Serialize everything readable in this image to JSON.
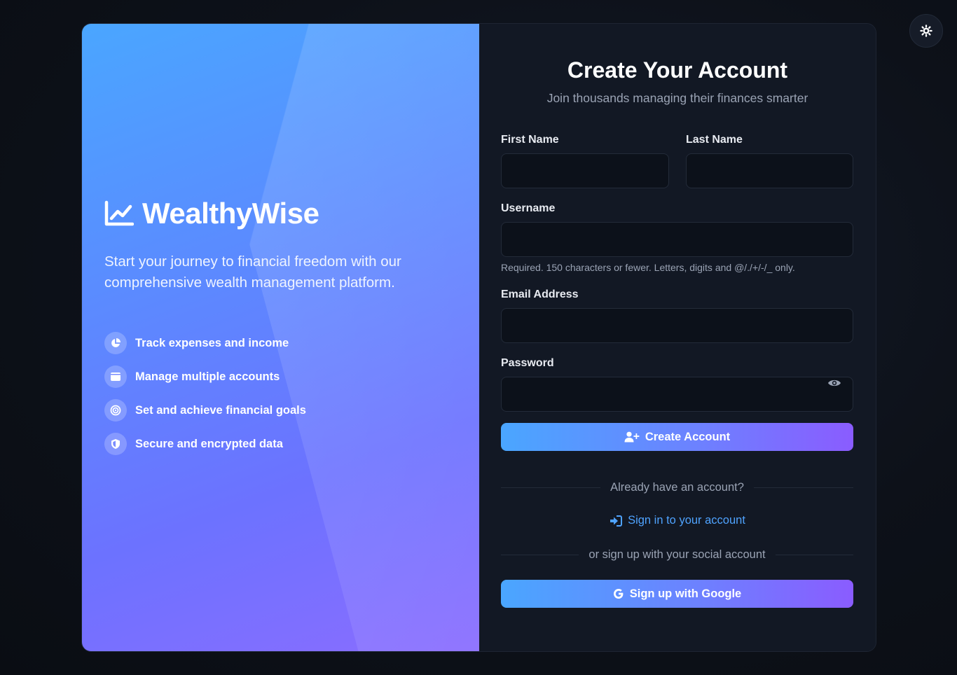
{
  "brand": {
    "name": "WealthyWise",
    "icon": "chart-line-icon"
  },
  "hero": {
    "tagline": "Start your journey to financial freedom with our comprehensive wealth management platform.",
    "features": [
      {
        "icon": "pie-chart-icon",
        "label": "Track expenses and income"
      },
      {
        "icon": "wallet-icon",
        "label": "Manage multiple accounts"
      },
      {
        "icon": "target-icon",
        "label": "Set and achieve financial goals"
      },
      {
        "icon": "shield-icon",
        "label": "Secure and encrypted data"
      }
    ]
  },
  "form": {
    "title": "Create Your Account",
    "subtitle": "Join thousands managing their finances smarter",
    "first_name": {
      "label": "First Name",
      "value": ""
    },
    "last_name": {
      "label": "Last Name",
      "value": ""
    },
    "username": {
      "label": "Username",
      "value": "",
      "help": "Required. 150 characters or fewer. Letters, digits and @/./+/-/_ only."
    },
    "email": {
      "label": "Email Address",
      "value": ""
    },
    "password": {
      "label": "Password",
      "value": ""
    },
    "submit_label": "Create Account",
    "already_text": "Already have an account?",
    "signin_label": "Sign in to your account",
    "social_text": "or sign up with your social account",
    "google_label": "Sign up with Google"
  },
  "colors": {
    "accent": "#4fa3ff",
    "gradient_start": "#4aa6ff",
    "gradient_end": "#8a5cff",
    "panel_bg": "#121824",
    "input_bg": "#0c111a"
  },
  "theme_toggle_icon": "sun-gear-icon"
}
